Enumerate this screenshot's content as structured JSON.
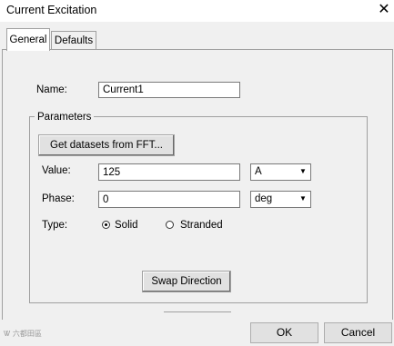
{
  "window": {
    "title": "Current Excitation"
  },
  "tabs": [
    {
      "label": "General",
      "active": true
    },
    {
      "label": "Defaults",
      "active": false
    }
  ],
  "form": {
    "name_label": "Name:",
    "name_value": "Current1",
    "parameters_label": "Parameters",
    "get_datasets_label": "Get datasets from FFT...",
    "value_label": "Value:",
    "value_value": "125",
    "value_unit": "A",
    "phase_label": "Phase:",
    "phase_value": "0",
    "phase_unit": "deg",
    "type_label": "Type:",
    "type_options": [
      {
        "label": "Solid",
        "selected": true
      },
      {
        "label": "Stranded",
        "selected": false
      }
    ],
    "swap_direction_label": "Swap Direction"
  },
  "footer": {
    "ok_label": "OK",
    "cancel_label": "Cancel",
    "watermark": "Ꮤ 六都田區"
  }
}
